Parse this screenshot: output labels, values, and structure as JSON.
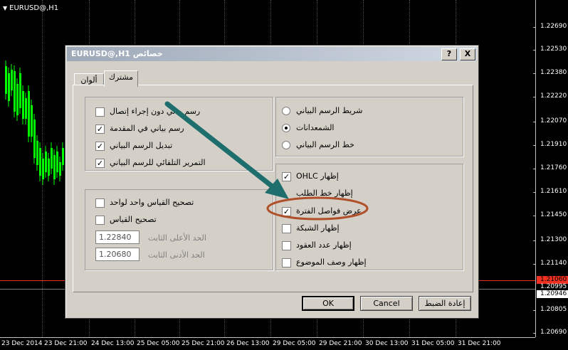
{
  "chart": {
    "title": "EURUSD@,H1",
    "prices": [
      {
        "label": "1.22690",
        "level": 1.2269
      },
      {
        "label": "1.22530",
        "level": 1.2253
      },
      {
        "label": "1.22380",
        "level": 1.2238
      },
      {
        "label": "1.22220",
        "level": 1.2222
      },
      {
        "label": "1.22070",
        "level": 1.2207
      },
      {
        "label": "1.21910",
        "level": 1.2191
      },
      {
        "label": "1.21760",
        "level": 1.2176
      },
      {
        "label": "1.21610",
        "level": 1.2161
      },
      {
        "label": "1.21450",
        "level": 1.2145
      },
      {
        "label": "1.21300",
        "level": 1.213
      },
      {
        "label": "1.21140",
        "level": 1.2114
      },
      {
        "label": "1.20805",
        "level": 1.20805
      },
      {
        "label": "1.20690",
        "level": 1.2069
      }
    ],
    "ask_price": "1.21060",
    "bid_line_price": "1.20995",
    "current_price": "1.20946",
    "times": [
      "23 Dec 2014",
      "23 Dec 21:00",
      "24 Dec 13:00",
      "25 Dec 05:00",
      "25 Dec 21:00",
      "26 Dec 13:00",
      "29 Dec 05:00",
      "29 Dec 21:00",
      "30 Dec 13:00",
      "31 Dec 05:00",
      "31 Dec 21:00"
    ],
    "colors": {
      "grid": "#4a4a4a",
      "bull": "#00ff00",
      "ask_line": "#f03020",
      "bid_line": "#7a7a7a"
    }
  },
  "dialog": {
    "title": "EURUSD@,H1 خصائص",
    "help_glyph": "?",
    "close_glyph": "X",
    "tabs": {
      "colors": "ألوان",
      "common": "مشترك"
    },
    "left_top_group": [
      {
        "label": "رسم بياني دون إجراء إتصال",
        "checked": false,
        "glyph": ""
      },
      {
        "label": "رسم بياني في المقدمة",
        "checked": true,
        "glyph": "✓"
      },
      {
        "label": "تبديل الرسم البياني",
        "checked": true,
        "glyph": "✓"
      },
      {
        "label": "التمرير التلقائي للرسم البياني",
        "checked": true,
        "glyph": "✓"
      }
    ],
    "scale_group": {
      "one_to_one": {
        "label": "تصحيح القياس واحد لواحد",
        "checked": false,
        "glyph": ""
      },
      "fix_scale": {
        "label": "تصحيح القياس",
        "checked": false,
        "glyph": ""
      },
      "max": {
        "label": "الحد الأعلى الثابت",
        "value": "1.22840"
      },
      "min": {
        "label": "الحد الأدنى الثابت",
        "value": "1.20680"
      }
    },
    "chart_type_group": [
      {
        "label": "شريط الرسم البياني",
        "selected": false
      },
      {
        "label": "الشمعدانات",
        "selected": true
      },
      {
        "label": "خط الرسم البياني",
        "selected": false
      }
    ],
    "show_group": [
      {
        "label": "OHLC إظهار",
        "checked": true,
        "glyph": "✓"
      },
      {
        "label": "إظهار خط الطلب",
        "checked": false,
        "glyph": ""
      },
      {
        "label": "عرض فواصل الفترة",
        "checked": true,
        "glyph": "✓"
      },
      {
        "label": "إظهار الشبكة",
        "checked": false,
        "glyph": ""
      },
      {
        "label": "إظهار عدد العقود",
        "checked": false,
        "glyph": ""
      },
      {
        "label": "إظهار وصف الموضوع",
        "checked": false,
        "glyph": ""
      }
    ],
    "buttons": {
      "ok": "OK",
      "cancel": "Cancel",
      "reset": "إعادة الضبط"
    },
    "annotation_colors": {
      "arrow": "#1e6e6e",
      "ellipse": "#b0502a"
    }
  }
}
